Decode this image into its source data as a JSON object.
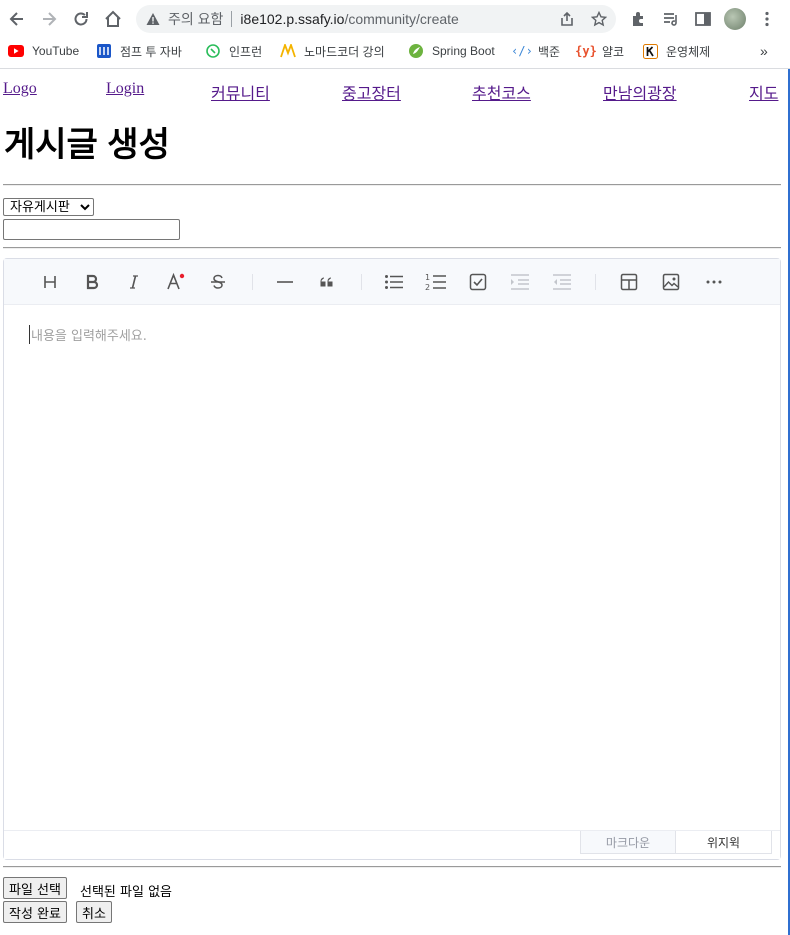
{
  "browser": {
    "security_label": "주의 요함",
    "url_host": "i8e102.p.ssafy.io",
    "url_path": "/community/create",
    "bookmarks": [
      {
        "label": "YouTube",
        "icon": "youtube-icon"
      },
      {
        "label": "점프 투 자바",
        "icon": "wikidocs-icon"
      },
      {
        "label": "인프런",
        "icon": "inflearn-icon"
      },
      {
        "label": "노마드코더 강의",
        "icon": "nomadcoders-icon"
      },
      {
        "label": "Spring Boot",
        "icon": "spring-icon"
      },
      {
        "label": "백준",
        "icon": "code-icon"
      },
      {
        "label": "얄코",
        "icon": "yalco-icon"
      },
      {
        "label": "운영체제",
        "icon": "kocw-icon"
      }
    ],
    "overflow_label": "»"
  },
  "nav": {
    "logo": "Logo",
    "login": "Login",
    "community": "커뮤니티",
    "market": "중고장터",
    "courses": "추천코스",
    "plaza": "만남의광장",
    "map": "지도"
  },
  "page": {
    "title": "게시글 생성",
    "board_options": [
      "자유게시판"
    ],
    "board_selected": "자유게시판",
    "title_value": ""
  },
  "editor": {
    "placeholder": "내용을 입력해주세요.",
    "toolbar": [
      "heading-icon",
      "bold-icon",
      "italic-icon",
      "text-color-icon",
      "strike-icon",
      "hr-icon",
      "quote-icon",
      "bullet-list-icon",
      "ordered-list-icon",
      "task-list-icon",
      "indent-icon",
      "outdent-icon",
      "table-icon",
      "image-icon",
      "more-icon"
    ],
    "mode_markdown": "마크다운",
    "mode_wysiwyg": "위지윅"
  },
  "form": {
    "file_button": "파일 선택",
    "file_status": "선택된 파일 없음",
    "submit": "작성 완료",
    "cancel": "취소"
  }
}
